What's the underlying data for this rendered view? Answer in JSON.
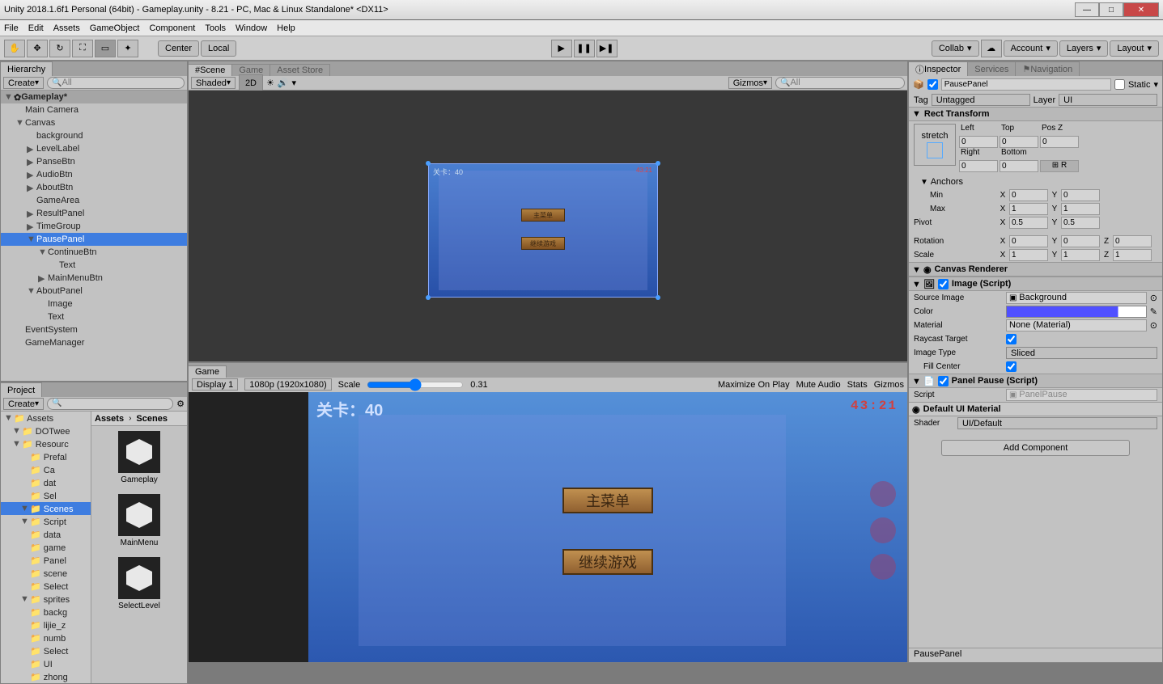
{
  "title": "Unity 2018.1.6f1 Personal (64bit) - Gameplay.unity - 8.21 - PC, Mac & Linux Standalone* <DX11>",
  "menu": [
    "File",
    "Edit",
    "Assets",
    "GameObject",
    "Component",
    "Tools",
    "Window",
    "Help"
  ],
  "toolbar": {
    "center": "Center",
    "local": "Local",
    "collab": "Collab",
    "account": "Account",
    "layers": "Layers",
    "layout": "Layout"
  },
  "hierarchy": {
    "title": "Hierarchy",
    "create": "Create",
    "search": "All",
    "scene": "Gameplay*",
    "items": [
      {
        "name": "Main Camera",
        "indent": 1
      },
      {
        "name": "Canvas",
        "indent": 1,
        "fold": "▼"
      },
      {
        "name": "background",
        "indent": 2
      },
      {
        "name": "LevelLabel",
        "indent": 2,
        "fold": "▶"
      },
      {
        "name": "PanseBtn",
        "indent": 2,
        "fold": "▶"
      },
      {
        "name": "AudioBtn",
        "indent": 2,
        "fold": "▶"
      },
      {
        "name": "AboutBtn",
        "indent": 2,
        "fold": "▶"
      },
      {
        "name": "GameArea",
        "indent": 2
      },
      {
        "name": "ResultPanel",
        "indent": 2,
        "fold": "▶"
      },
      {
        "name": "TimeGroup",
        "indent": 2,
        "fold": "▶"
      },
      {
        "name": "PausePanel",
        "indent": 2,
        "fold": "▼",
        "sel": true
      },
      {
        "name": "ContinueBtn",
        "indent": 3,
        "fold": "▼"
      },
      {
        "name": "Text",
        "indent": 4
      },
      {
        "name": "MainMenuBtn",
        "indent": 3,
        "fold": "▶"
      },
      {
        "name": "AboutPanel",
        "indent": 2,
        "fold": "▼"
      },
      {
        "name": "Image",
        "indent": 3
      },
      {
        "name": "Text",
        "indent": 3
      },
      {
        "name": "EventSystem",
        "indent": 1
      },
      {
        "name": "GameManager",
        "indent": 1
      }
    ]
  },
  "scene": {
    "tab_scene": "Scene",
    "tab_game": "Game",
    "tab_asset": "Asset Store",
    "shaded": "Shaded",
    "twod": "2D",
    "gizmos": "Gizmos",
    "search": "All",
    "level": "关卡：40",
    "time": "43:21",
    "btn1": "主菜单",
    "btn2": "继续游戏"
  },
  "project": {
    "title": "Project",
    "create": "Create",
    "crumb1": "Assets",
    "crumb2": "Scenes",
    "tree": [
      "Assets",
      "DOTwee",
      "Resourc",
      "Prefal",
      "Ca",
      "dat",
      "Sel",
      "Scenes",
      "Script",
      "data",
      "game",
      "Panel",
      "scene",
      "Select",
      "sprites",
      "backg",
      "lijie_z",
      "numb",
      "Select",
      "UI",
      "zhong"
    ],
    "assets": [
      "Gameplay",
      "MainMenu",
      "SelectLevel"
    ]
  },
  "game": {
    "display": "Display 1",
    "res": "1080p (1920x1080)",
    "scale": "Scale",
    "scale_val": "0.31",
    "max": "Maximize On Play",
    "mute": "Mute Audio",
    "stats": "Stats",
    "gizmos": "Gizmos",
    "level": "关卡：40",
    "time": "43:21",
    "btn1": "主菜单",
    "btn2": "继续游戏"
  },
  "inspector": {
    "tab_insp": "Inspector",
    "tab_serv": "Services",
    "tab_nav": "Navigation",
    "name": "PausePanel",
    "static": "Static",
    "tag": "Tag",
    "tag_val": "Untagged",
    "layer": "Layer",
    "layer_val": "UI",
    "rect": {
      "title": "Rect Transform",
      "stretch": "stretch",
      "left": "Left",
      "top": "Top",
      "posz": "Pos Z",
      "right": "Right",
      "bottom": "Bottom",
      "left_v": "0",
      "top_v": "0",
      "posz_v": "0",
      "right_v": "0",
      "bottom_v": "0",
      "anchors": "Anchors",
      "min": "Min",
      "max": "Max",
      "pivot": "Pivot",
      "min_x": "0",
      "min_y": "0",
      "max_x": "1",
      "max_y": "1",
      "pivot_x": "0.5",
      "pivot_y": "0.5",
      "rotation": "Rotation",
      "rot_x": "0",
      "rot_y": "0",
      "rot_z": "0",
      "scale": "Scale",
      "scale_x": "1",
      "scale_y": "1",
      "scale_z": "1"
    },
    "canvas": "Canvas Renderer",
    "image": {
      "title": "Image (Script)",
      "src": "Source Image",
      "src_v": "Background",
      "color": "Color",
      "material": "Material",
      "mat_v": "None (Material)",
      "raycast": "Raycast Target",
      "type": "Image Type",
      "type_v": "Sliced",
      "fill": "Fill Center"
    },
    "pause": {
      "title": "Panel Pause (Script)",
      "script": "Script",
      "script_v": "PanelPause"
    },
    "mat": {
      "name": "Default UI Material",
      "shader": "Shader",
      "shader_v": "UI/Default"
    },
    "add": "Add Component",
    "footer": "PausePanel"
  }
}
